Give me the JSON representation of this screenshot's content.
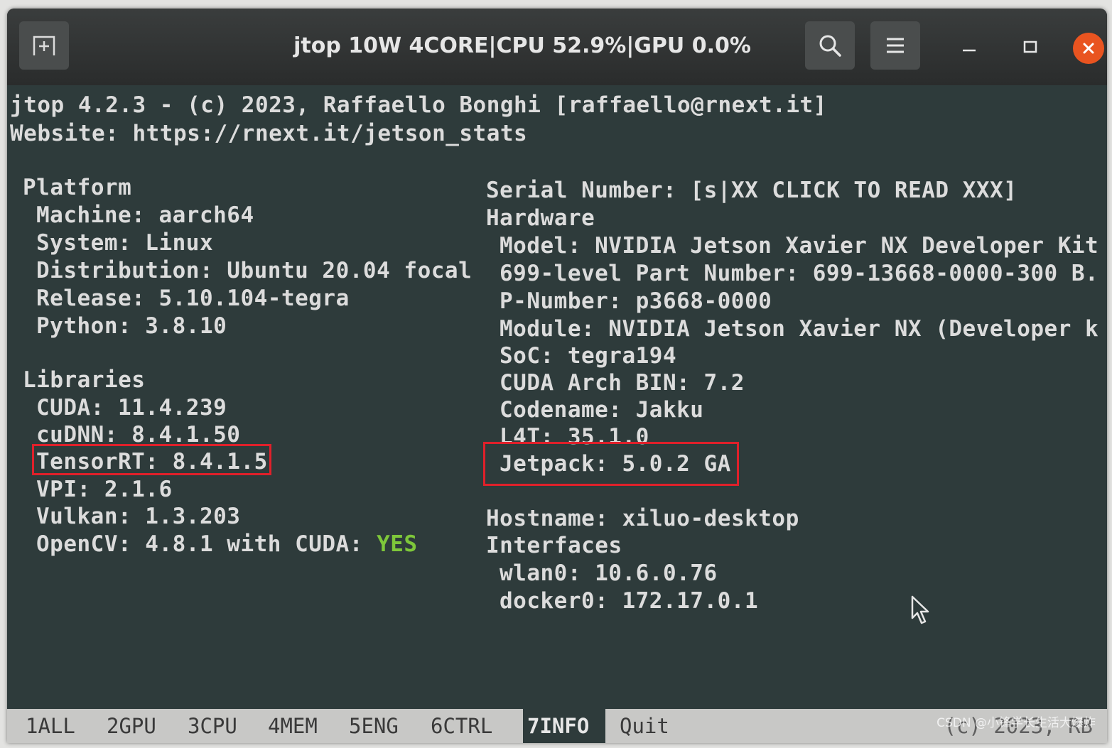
{
  "window": {
    "title": "jtop 10W 4CORE|CPU 52.9%|GPU 0.0%"
  },
  "icons": {
    "new_tab": "new-tab-icon",
    "search": "search-icon",
    "menu": "hamburger-menu-icon",
    "minimize": "minimize-icon",
    "maximize": "maximize-icon",
    "close": "close-icon",
    "cursor": "mouse-pointer-icon"
  },
  "colors": {
    "terminal_bg": "#2e3b3b",
    "text": "#dcdcdc",
    "yes_green": "#7ec73a",
    "highlight_red": "#e0202a",
    "close_orange": "#e95420"
  },
  "terminal": {
    "header_line1": "jtop 4.2.3 - (c) 2023, Raffaello Bonghi [raffaello@rnext.it]",
    "header_line2": "Website: https://rnext.it/jetson_stats",
    "platform": {
      "heading": "Platform",
      "machine": "Machine: aarch64",
      "system": "System: Linux",
      "distribution": "Distribution: Ubuntu 20.04 focal",
      "release": "Release: 5.10.104-tegra",
      "python": "Python: 3.8.10"
    },
    "libraries": {
      "heading": "Libraries",
      "cuda": "CUDA: 11.4.239",
      "cudnn": "cuDNN: 8.4.1.50",
      "tensorrt": "TensorRT: 8.4.1.5",
      "vpi": "VPI: 2.1.6",
      "vulkan": "Vulkan: 1.3.203",
      "opencv_prefix": "OpenCV: 4.8.1 with CUDA: ",
      "opencv_cuda": "YES"
    },
    "serial_number": "Serial Number: [s|XX CLICK TO READ XXX]",
    "hardware": {
      "heading": "Hardware",
      "model": "Model: NVIDIA Jetson Xavier NX Developer Kit",
      "part_number": "699-level Part Number: 699-13668-0000-300 B.",
      "p_number": "P-Number: p3668-0000",
      "module": "Module: NVIDIA Jetson Xavier NX (Developer k",
      "soc": "SoC: tegra194",
      "cuda_arch": "CUDA Arch BIN: 7.2",
      "codename": "Codename: Jakku",
      "l4t": "L4T: 35.1.0",
      "jetpack": "Jetpack: 5.0.2 GA"
    },
    "hostname": "Hostname: xiluo-desktop",
    "interfaces": {
      "heading": "Interfaces",
      "wlan0": "wlan0: 10.6.0.76",
      "docker0": "docker0: 172.17.0.1"
    }
  },
  "tabbar": {
    "tabs": [
      "1ALL",
      "2GPU",
      "3CPU",
      "4MEM",
      "5ENG",
      "6CTRL",
      "7INFO"
    ],
    "active_tab": "7INFO",
    "quit": "Quit",
    "copyright": "(c) 2023, RB"
  },
  "watermark": "CSDN @小锋学长生活大爆炸"
}
